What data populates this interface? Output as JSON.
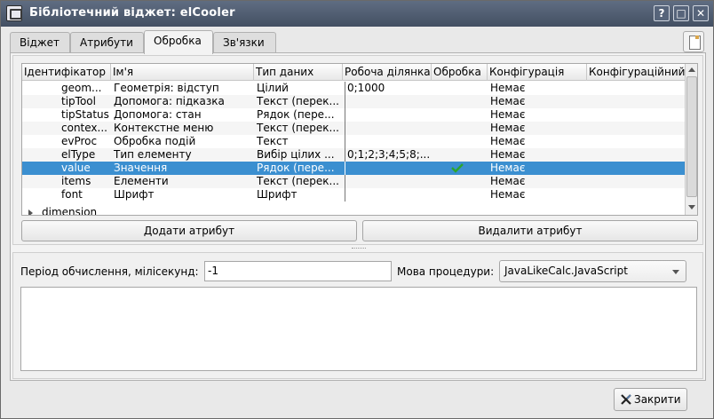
{
  "window": {
    "title": "Бібліотечний віджет: elCooler"
  },
  "title_buttons": {
    "help": "?",
    "maximize": "□",
    "close": "✕"
  },
  "tabs": [
    {
      "label": "Віджет"
    },
    {
      "label": "Атрибути"
    },
    {
      "label": "Обробка",
      "active": true
    },
    {
      "label": "Зв'язки"
    }
  ],
  "table": {
    "columns": [
      "Ідентифікатор",
      "Ім'я",
      "Тип даних",
      "Робоча ділянка",
      "Обробка",
      "Конфігурація",
      "Конфігураційний"
    ],
    "rows": [
      {
        "id": "geom...",
        "name": "Геометрія: відступ",
        "type": "Цілий",
        "workspace": "0;1000",
        "processing": "",
        "config": "Немає"
      },
      {
        "id": "tipTool",
        "name": "Допомога: підказка",
        "type": "Текст (перек...",
        "workspace": "",
        "processing": "",
        "config": "Немає"
      },
      {
        "id": "tipStatus",
        "name": "Допомога: стан",
        "type": "Рядок (пере...",
        "workspace": "",
        "processing": "",
        "config": "Немає"
      },
      {
        "id": "contex...",
        "name": "Контекстне меню",
        "type": "Текст (перек...",
        "workspace": "",
        "processing": "",
        "config": "Немає"
      },
      {
        "id": "evProc",
        "name": "Обробка подій",
        "type": "Текст",
        "workspace": "",
        "processing": "",
        "config": "Немає"
      },
      {
        "id": "elType",
        "name": "Тип елементу",
        "type": "Вибір цілих ...",
        "workspace": "0;1;2;3;4;5;8;...",
        "processing": "",
        "config": "Немає"
      },
      {
        "id": "value",
        "name": "Значення",
        "type": "Рядок (пере...",
        "workspace": "",
        "processing": "check",
        "config": "Немає",
        "selected": true
      },
      {
        "id": "items",
        "name": "Елементи",
        "type": "Текст (перек...",
        "workspace": "",
        "processing": "",
        "config": "Немає"
      },
      {
        "id": "font",
        "name": "Шрифт",
        "type": "Шрифт",
        "workspace": "",
        "processing": "",
        "config": "Немає"
      }
    ],
    "group_row": {
      "label": "dimension",
      "expanded": false
    }
  },
  "buttons": {
    "add_attribute": "Додати атрибут",
    "delete_attribute": "Видалити атрибут",
    "close": "Закрити"
  },
  "form": {
    "period_label": "Період обчислення, мілісекунд:",
    "period_value": "-1",
    "language_label": "Мова процедури:",
    "language_value": "JavaLikeCalc.JavaScript",
    "code": ""
  },
  "colors": {
    "selection": "#3b8fd0",
    "titlebar": "#4b576b",
    "check": "#2ca52c"
  }
}
